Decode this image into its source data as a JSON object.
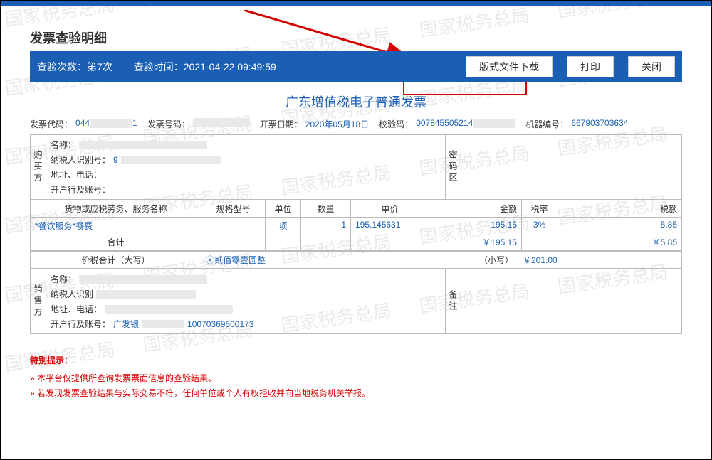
{
  "watermark_text": "国家税务总局",
  "page_title": "发票查验明细",
  "header": {
    "check_count_label": "查验次数：",
    "check_count_value": "第7次",
    "check_time_label": "查验时间：",
    "check_time_value": "2021-04-22 09:49:59",
    "btn_download": "版式文件下载",
    "btn_print": "打印",
    "btn_close": "关闭"
  },
  "invoice_title": "广东增值税电子普通发票",
  "meta": {
    "code_label": "发票代码：",
    "code_value_prefix": "044",
    "code_value_suffix": "1",
    "number_label": "发票号码：",
    "date_label": "开票日期：",
    "date_value": "2020年05月18日",
    "check_label": "校验码：",
    "check_value_prefix": "007845505214",
    "machine_label": "机器编号：",
    "machine_value": "667903703634"
  },
  "buyer": {
    "section_label": "购买方",
    "name_label": "名称：",
    "taxid_label": "纳税人识别号：",
    "taxid_prefix": "9",
    "addr_label": "地址、电话：",
    "bank_label": "开户行及账号：",
    "code_section_label": "密码区"
  },
  "items_header": {
    "name": "货物或应税劳务、服务名称",
    "spec": "规格型号",
    "unit": "单位",
    "qty": "数量",
    "price": "单价",
    "amount": "金额",
    "rate": "税率",
    "tax": "税额"
  },
  "items": [
    {
      "name": "*餐饮服务*餐费",
      "spec": "",
      "unit": "项",
      "qty": "1",
      "price": "195.145631",
      "amount": "195.15",
      "rate": "3%",
      "tax": "5.85"
    }
  ],
  "totals": {
    "sum_label": "合计",
    "sum_amount": "￥195.15",
    "sum_tax": "￥5.85",
    "cn_label": "价税合计（大写）",
    "cn_value": "ⓧ贰佰零壹圆整",
    "low_label": "（小写）",
    "low_value": "￥201.00"
  },
  "seller": {
    "section_label": "销售方",
    "name_label": "名称：",
    "taxid_label": "纳税人识别",
    "addr_label": "地址、电话：",
    "bank_label": "开户行及账号：",
    "bank_prefix": "广发银",
    "bank_suffix": "10070369600173",
    "remark_label": "备注"
  },
  "tips": {
    "title": "特别提示：",
    "l1": "» 本平台仅提供所查询发票票面信息的查验结果。",
    "l2": "» 若发现发票查验结果与实际交易不符，任何单位或个人有权拒收并向当地税务机关举报。"
  }
}
